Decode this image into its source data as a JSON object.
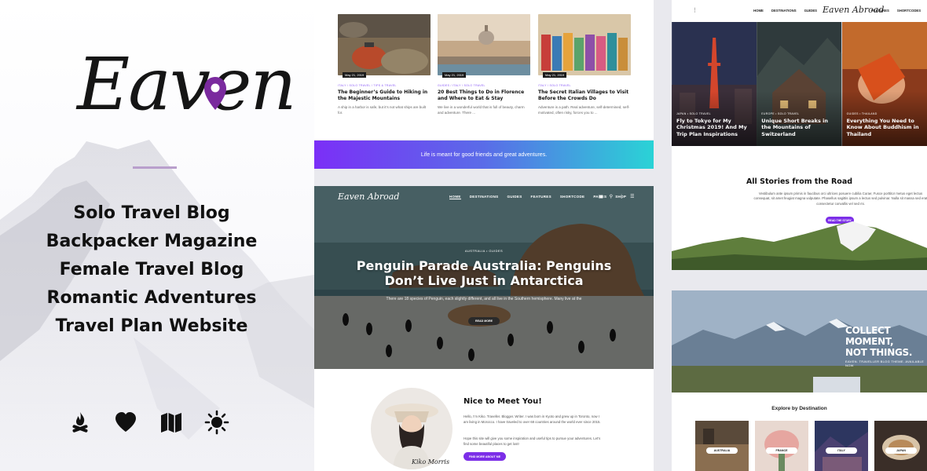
{
  "brand": {
    "logo_text": "Eaven",
    "accent": "#7c2ee8"
  },
  "promo": {
    "taglines": [
      "Solo Travel Blog",
      "Backpacker Magazine",
      "Female Travel Blog",
      "Romantic Adventures",
      "Travel Plan Website"
    ],
    "icons": [
      "campfire-icon",
      "heart-icon",
      "map-icon",
      "sun-icon"
    ]
  },
  "posts": [
    {
      "date": "May 21, 2019",
      "cats": "Italy / Solo Travel / Tips & Travel",
      "title": "The Beginner’s Guide to Hiking in the Majestic Mountains",
      "excerpt": "A ship in a harbor is safe, but it’s not what ships are built for."
    },
    {
      "date": "May 21, 2019",
      "cats": "Guides / Italy / Solo Travel",
      "title": "20 Best Things to Do in Florence and Where to Eat & Stay",
      "excerpt": "We live in a wonderful world that is full of beauty, charm and adventure. There ..."
    },
    {
      "date": "May 21, 2019",
      "cats": "Italy / Solo Travel",
      "title": "The Secret Italian Villages to Visit Before the Crowds Do",
      "excerpt": "Adventure is a path. Real adventure, self-determined, self-motivated, often risky, forces you to ..."
    }
  ],
  "banner_text": "Life is meant for good friends and great adventures.",
  "hero": {
    "brand": "Eaven Abroad",
    "nav": [
      "HOME",
      "DESTINATIONS",
      "GUIDES",
      "FEATURES",
      "SHORTCODE",
      "PAGES",
      "SHOP"
    ],
    "nav_icons": [
      "cart-icon",
      "search-icon",
      "more-icon",
      "menu-icon"
    ],
    "category": "AUSTRALIA  •  GUIDES",
    "title": "Penguin Parade Australia: Penguins Don’t Live Just in Antarctica",
    "subtitle": "There are 18 species of Penguin, each slightly different, and all live in the Southern hemisphere. Many live at the",
    "button": "READ MORE"
  },
  "about": {
    "title": "Nice to Meet You!",
    "p1": "Hello, I’m Kiko. Traveller. Blogger. Writer. I was born in Kyoto and grew up in Toronto, now I am living in Morocco. I have traveled to over 68 countries around the world ever since 2015.",
    "p2": "Hope this site will give you some inspiration and useful tips to pursue your adventures. Let’s find some beautiful places to get lost!",
    "button": "FIND MORE ABOUT ME",
    "signature": "Kiko Morris"
  },
  "right": {
    "nav_left": [
      "HOME",
      "DESTINATIONS",
      "GUIDES"
    ],
    "brand": "Eaven Abroad",
    "nav_right": [
      "FEATURES",
      "SHORTCODES",
      "PA"
    ],
    "slides": [
      {
        "cat": "JAPAN  •  SOLO TRAVEL",
        "title": "Fly to Tokyo for My Christmas 2019! And My Trip Plan Inspirations"
      },
      {
        "cat": "EUROPE  •  SOLO TRAVEL",
        "title": "Unique Short Breaks in the Mountains of Switzerland"
      },
      {
        "cat": "GUIDES  •  THAILAND",
        "title": "Everything You Need to Know About Buddhism in Thailand"
      }
    ],
    "stories": {
      "title": "All Stories from the Road",
      "text": "Vestibulum ante ipsum primis in faucibus orci ultrices posuere cubilia Curae; Fusce porttitor metus eget lectus consequat, sit amet feugiat magna vulputate. Phasellus sagittis ipsum a lectus sed pulvinar. Nulla sit massa sed erat consectetur convallis vel sed mi.",
      "button": "READ THE STORY"
    },
    "collect": {
      "line1": "COLLECT MOMENT,",
      "line2": "NOT THINGS.",
      "small": "EAVEN. TRAVELLER BLOG THEME. AVAILABLE NOW"
    },
    "explore": {
      "title": "Explore by Destination",
      "destinations": [
        "AUSTRALIA",
        "FRANCE",
        "ITALY",
        "JAPAN"
      ]
    }
  }
}
